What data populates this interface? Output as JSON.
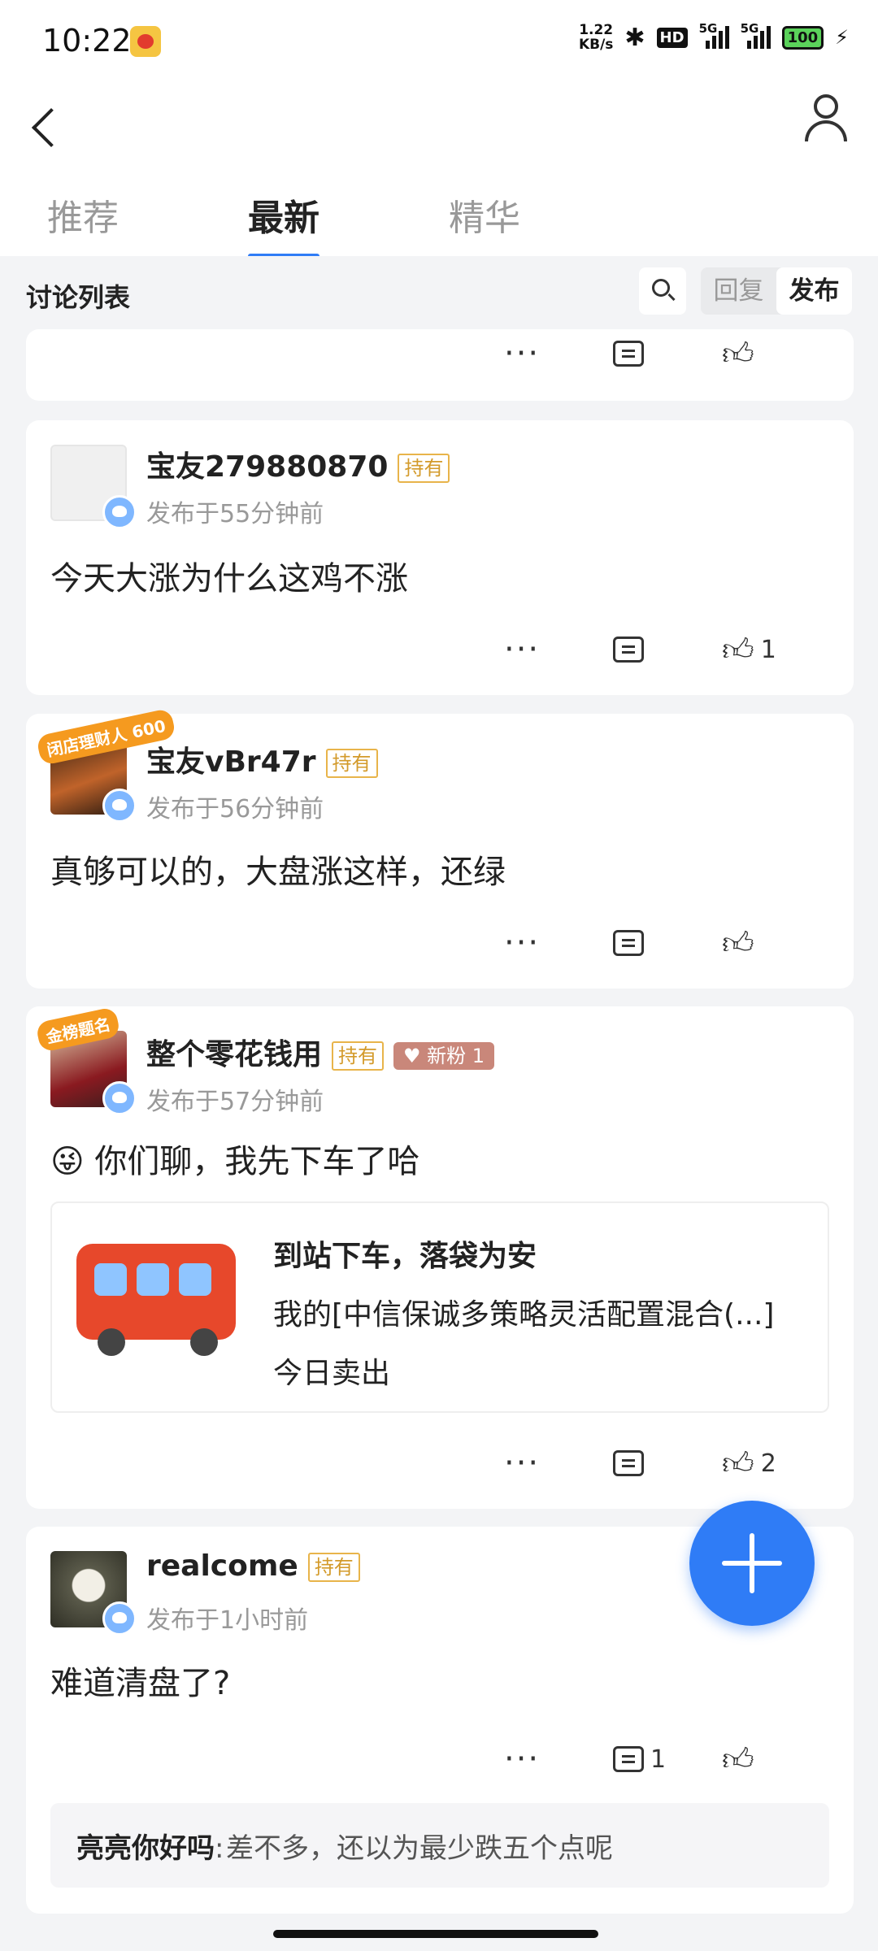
{
  "status_bar": {
    "time": "10:22",
    "net_speed_value": "1.22",
    "net_speed_unit": "KB/s",
    "hd_label": "HD",
    "sig1_label": "5G",
    "sig2_label": "5G",
    "battery": "100"
  },
  "tabs": [
    {
      "label": "推荐",
      "active": false
    },
    {
      "label": "最新",
      "active": true
    },
    {
      "label": "精华",
      "active": false
    }
  ],
  "section": {
    "title": "讨论列表",
    "filter_reply": "回复",
    "filter_post": "发布"
  },
  "posts": [
    {
      "username": "宝友279880870",
      "tag": "持有",
      "time": "发布于55分钟前",
      "content": "今天大涨为什么这鸡不涨",
      "comments": "",
      "likes": "1"
    },
    {
      "username": "宝友vBr47r",
      "tag": "持有",
      "frame_text": "闭店理财人 600",
      "time": "发布于56分钟前",
      "content": "真够可以的，大盘涨这样，还绿",
      "comments": "",
      "likes": ""
    },
    {
      "username": "整个零花钱用",
      "tag": "持有",
      "fan_tag": "新粉 1",
      "frame_text": "金榜题名",
      "time": "发布于57分钟前",
      "emoji": "😜",
      "content": "你们聊，我先下车了哈",
      "link": {
        "title": "到站下车，落袋为安",
        "desc": "我的[中信保诚多策略灵活配置混合(...]",
        "sub": "今日卖出"
      },
      "comments": "",
      "likes": "2"
    },
    {
      "username": "realcome",
      "tag": "持有",
      "time": "发布于1小时前",
      "content": "难道清盘了?",
      "comments": "1",
      "likes": "",
      "reply": {
        "who": "亮亮你好吗",
        "sep": ":",
        "text": "差不多，还以为最少跌五个点呢"
      }
    }
  ],
  "icons": {
    "back": "back-arrow-icon",
    "user": "user-icon",
    "search": "search-icon",
    "more": "more-icon",
    "comment": "comment-icon",
    "like": "thumbs-up-icon",
    "add": "plus-icon"
  },
  "colors": {
    "accent": "#2f7cf6",
    "hold_tag": "#d39a2a",
    "fan_tag": "#c9877a"
  }
}
